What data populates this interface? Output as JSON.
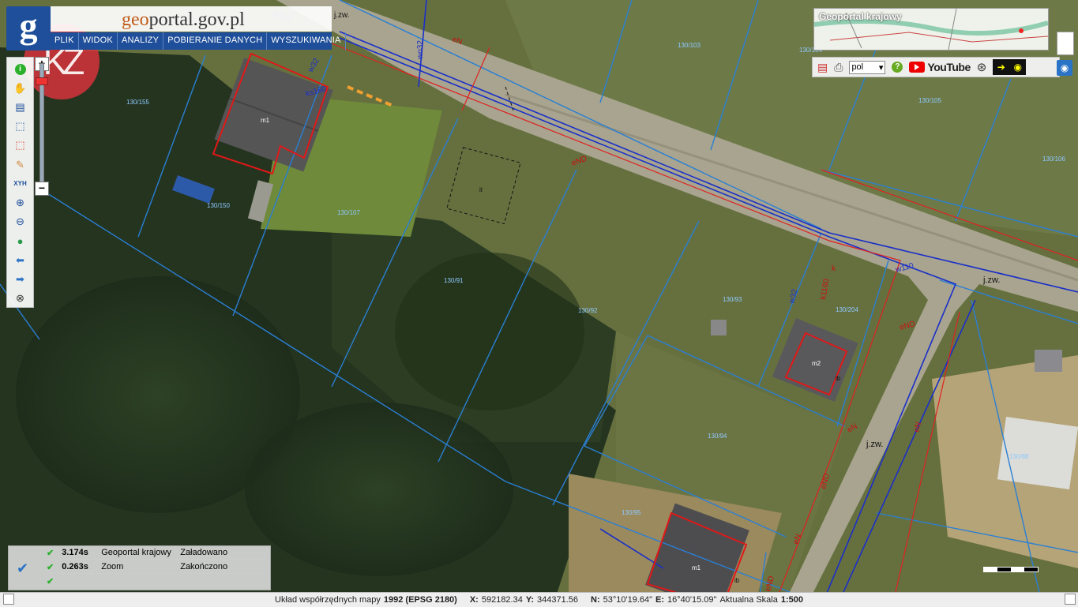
{
  "app": {
    "brand_prefix": "geo",
    "brand_suffix": "portal.gov.pl",
    "logo_letter": "g",
    "watermark": "KZ"
  },
  "menu": [
    {
      "label": "PLIK"
    },
    {
      "label": "WIDOK"
    },
    {
      "label": "ANALIZY"
    },
    {
      "label": "POBIERANIE DANYCH"
    },
    {
      "label": "WYSZUKIWANIA"
    }
  ],
  "toolbar": [
    {
      "name": "info-icon",
      "glyph": "i",
      "color": "#2ab02a"
    },
    {
      "name": "pan-hand-icon",
      "glyph": "✋",
      "color": "#d08a40"
    },
    {
      "name": "legend-icon",
      "glyph": "▤",
      "color": "#1f4f9a"
    },
    {
      "name": "select-area-icon",
      "glyph": "⬚",
      "color": "#1f4f9a"
    },
    {
      "name": "select-red-icon",
      "glyph": "⬚",
      "color": "#d32"
    },
    {
      "name": "pencil-icon",
      "glyph": "✎",
      "color": "#d08a40"
    },
    {
      "name": "xyh-icon",
      "glyph": "XYH",
      "color": "#1f4f9a"
    },
    {
      "name": "zoom-in-icon",
      "glyph": "⊕",
      "color": "#1f4f9a"
    },
    {
      "name": "zoom-out-icon",
      "glyph": "⊖",
      "color": "#1f4f9a"
    },
    {
      "name": "globe-icon",
      "glyph": "●",
      "color": "#2a9a4a"
    },
    {
      "name": "back-arrow-icon",
      "glyph": "⬅",
      "color": "#2a73c6"
    },
    {
      "name": "forward-arrow-icon",
      "glyph": "➡",
      "color": "#2a73c6"
    },
    {
      "name": "compass-icon",
      "glyph": "⊗",
      "color": "#333"
    }
  ],
  "overview": {
    "title": "Geoportal krajowy"
  },
  "tools_right": {
    "lang": "pol",
    "youtube": "YouTube"
  },
  "status": [
    {
      "time": "3.174s",
      "name": "Geoportal krajowy",
      "state": "Załadowano"
    },
    {
      "time": "0.263s",
      "name": "Zoom",
      "state": "Zakończono"
    },
    {
      "time": "",
      "name": "",
      "state": ""
    }
  ],
  "bottom": {
    "crs_label": "Układ współrzędnych mapy",
    "crs_value": "1992 (EPSG 2180)",
    "x_label": "X:",
    "x_value": "592182.34",
    "y_label": "Y:",
    "y_value": "344371.56",
    "n_label": "N:",
    "n_value": "53°10'19.64\"",
    "e_label": "E:",
    "e_value": "16°40'15.09\"",
    "scale_label": "Aktualna Skala",
    "scale_value": "1:500"
  },
  "map_labels": {
    "jzw1": "j.zw.",
    "jzw2": "j.zw.",
    "jzw3": "j.zw.",
    "w110a": "w110",
    "w110b": "w110",
    "wo32": "wo32",
    "w32a": "w32",
    "w32b": "w32",
    "ks160": "ks160",
    "k1160": "k1160",
    "k": "k",
    "eN1": "eN",
    "eN2": "eN",
    "eN3": "eN",
    "eN4": "eN",
    "eND1": "eND",
    "eND2": "eND",
    "eND3": "eND",
    "eND4": "eND",
    "m1a": "m1",
    "m1b": "m1",
    "m2": "m2",
    "ib1": "ib",
    "ib2": "ib",
    "it": "it",
    "p130_155": "130/155",
    "p130_150": "130/150",
    "p130_107": "130/107",
    "p130_91": "130/91",
    "p130_92": "130/92",
    "p130_93": "130/93",
    "p130_94": "130/94",
    "p130_95": "130/95",
    "p130_103": "130/103",
    "p130_104": "130/104",
    "p130_105": "130/105",
    "p130_106": "130/106",
    "p130_88": "130/88",
    "p130_204": "130/204"
  }
}
